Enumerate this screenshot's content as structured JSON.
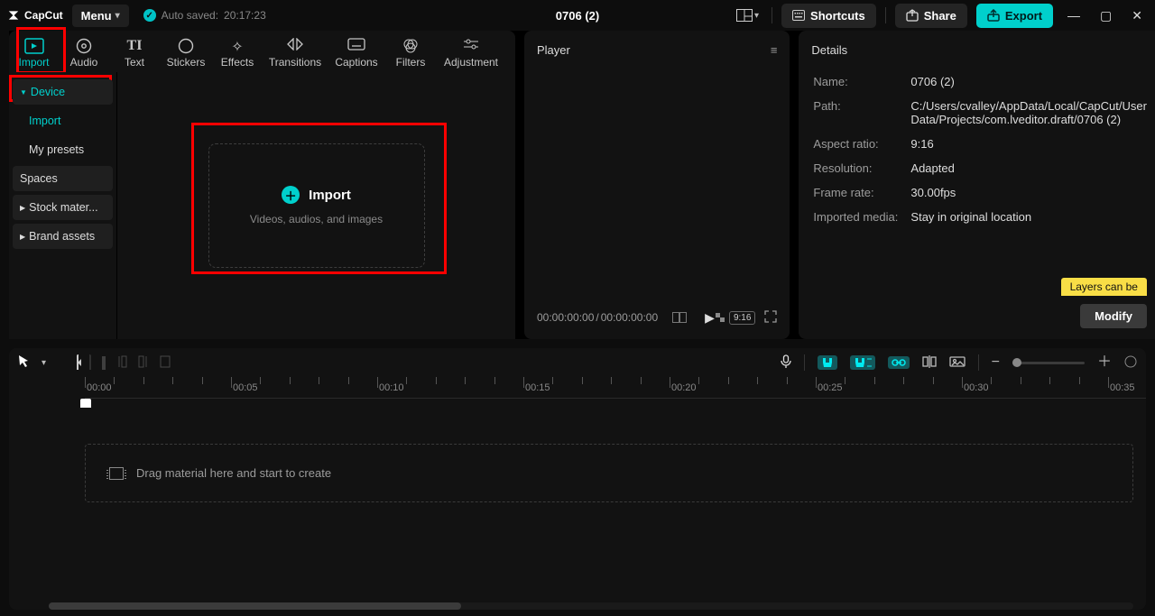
{
  "titlebar": {
    "app": "CapCut",
    "menu": "Menu",
    "autosave_prefix": "Auto saved:",
    "autosave_time": "20:17:23",
    "project_title": "0706 (2)",
    "shortcuts": "Shortcuts",
    "share": "Share",
    "export": "Export"
  },
  "tabs": {
    "import": "Import",
    "audio": "Audio",
    "text": "Text",
    "stickers": "Stickers",
    "effects": "Effects",
    "transitions": "Transitions",
    "captions": "Captions",
    "filters": "Filters",
    "adjustment": "Adjustment"
  },
  "sidebar": {
    "device": "Device",
    "import": "Import",
    "presets": "My presets",
    "spaces": "Spaces",
    "stock": "Stock mater...",
    "brand": "Brand assets"
  },
  "drop": {
    "title": "Import",
    "sub": "Videos, audios, and images"
  },
  "player": {
    "title": "Player",
    "time_current": "00:00:00:00",
    "time_sep": " / ",
    "time_total": "00:00:00:00",
    "ratio": "9:16"
  },
  "details": {
    "title": "Details",
    "name_lbl": "Name:",
    "name": "0706 (2)",
    "path_lbl": "Path:",
    "path": "C:/Users/cvalley/AppData/Local/CapCut/User Data/Projects/com.lveditor.draft/0706 (2)",
    "ratio_lbl": "Aspect ratio:",
    "ratio": "9:16",
    "res_lbl": "Resolution:",
    "res": "Adapted",
    "fps_lbl": "Frame rate:",
    "fps": "30.00fps",
    "imp_lbl": "Imported media:",
    "imp": "Stay in original location",
    "popup": "Layers can be",
    "modify": "Modify"
  },
  "timeline": {
    "ticks": [
      "00:00",
      "00:05",
      "00:10",
      "00:15",
      "00:20",
      "00:25",
      "00:30",
      "00:35"
    ],
    "track_hint": "Drag material here and start to create"
  }
}
